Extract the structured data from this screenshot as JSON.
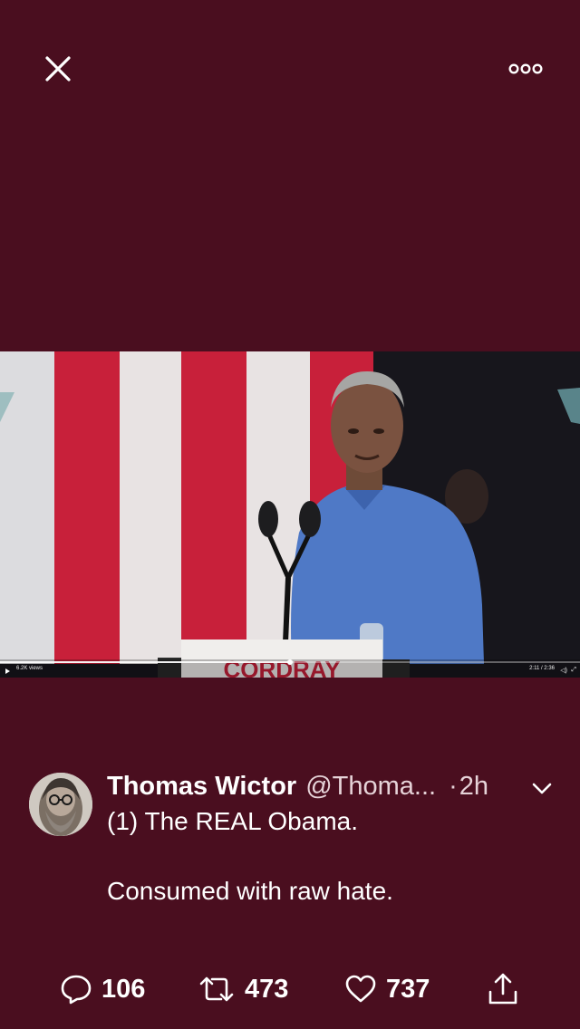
{
  "top_bar": {
    "close_icon": "close-icon",
    "more_icon": "more-options-icon"
  },
  "video": {
    "podium_sign": "CORDRAY",
    "views": "6.2K views",
    "time": "2:11 / 2:36",
    "progress": 0.5
  },
  "tweet": {
    "author_name": "Thomas Wictor",
    "author_handle": "@Thoma...",
    "separator": "·",
    "time_ago": "2h",
    "line1": "(1) The REAL Obama.",
    "line2": "Consumed with raw hate."
  },
  "actions": {
    "reply_count": "106",
    "retweet_count": "473",
    "like_count": "737"
  },
  "colors": {
    "background": "#4a0e1f",
    "text": "#ffffff",
    "secondary_text": "#e6d3d8"
  }
}
